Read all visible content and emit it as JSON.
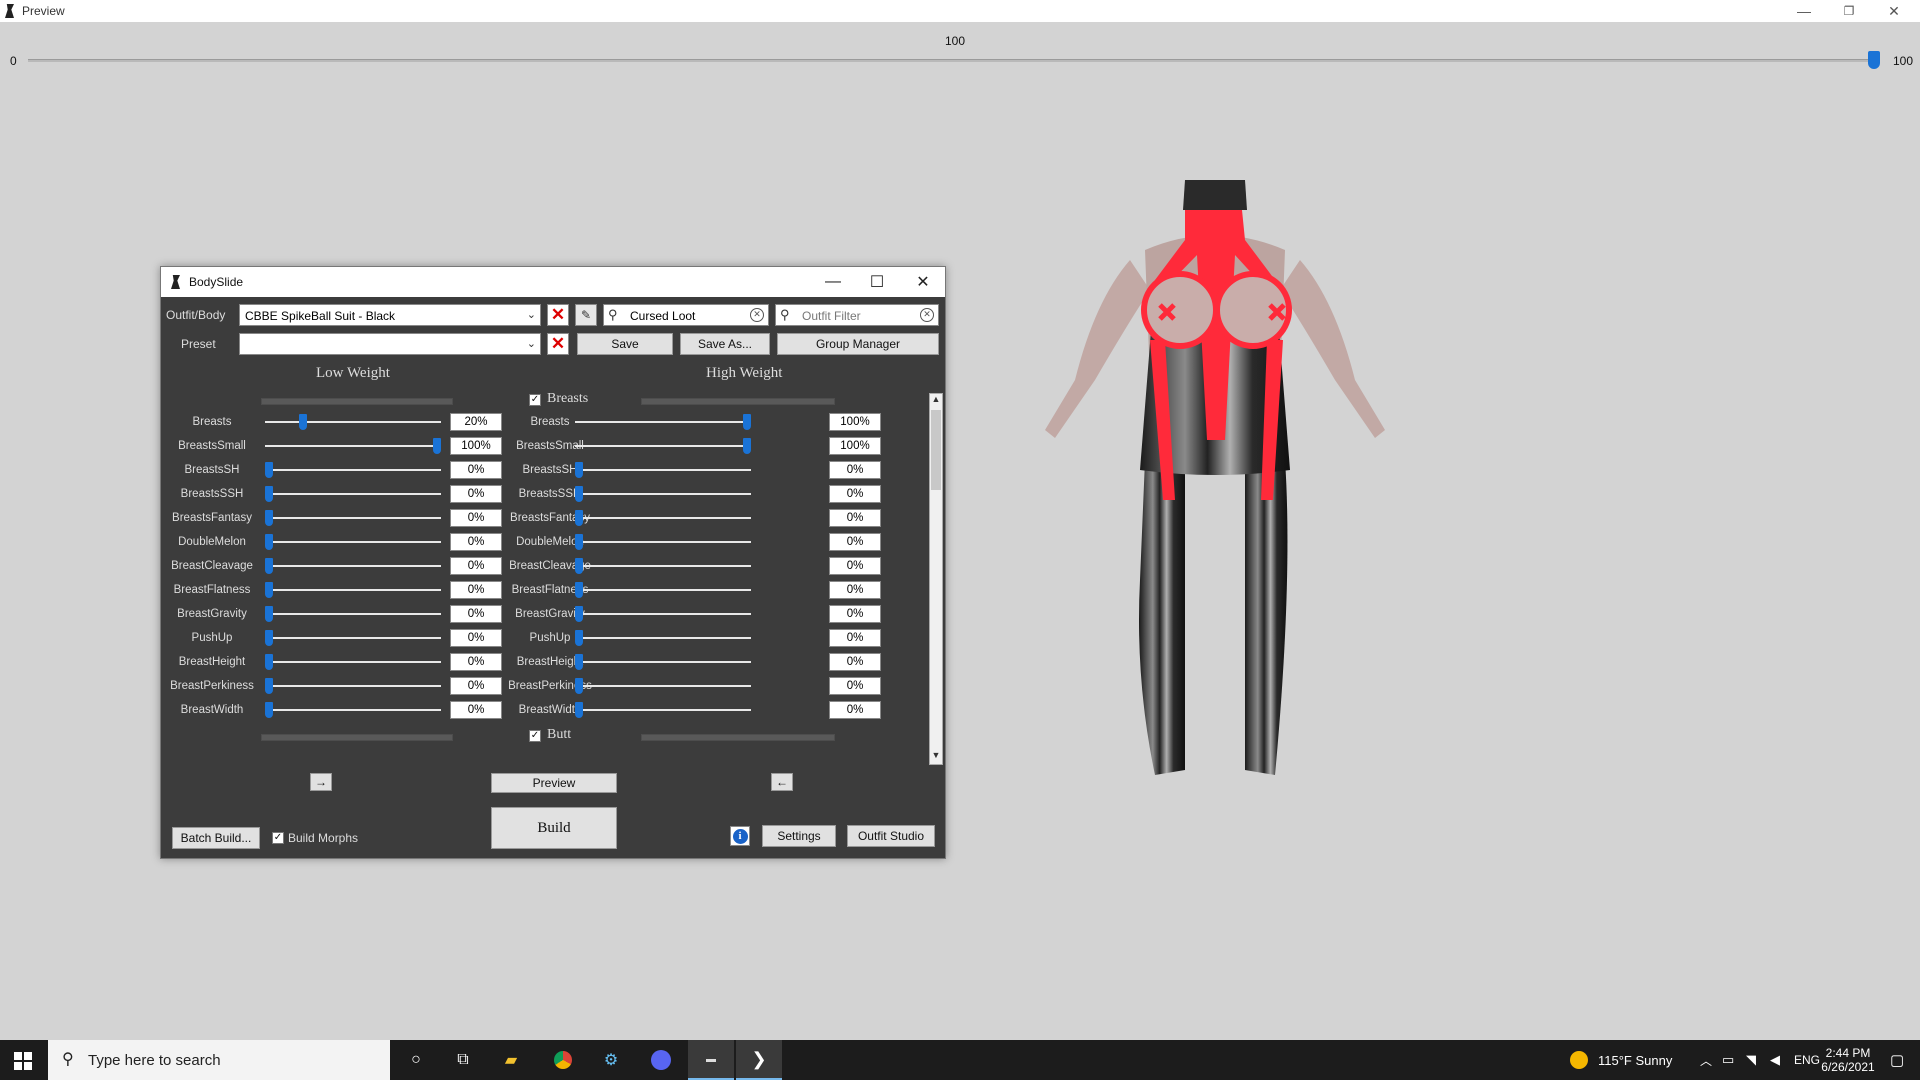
{
  "preview_window": {
    "title": "Preview",
    "controls": {
      "minimize": "—",
      "restore": "❐",
      "close": "✕"
    },
    "zoom": {
      "label": "100",
      "min": "0",
      "max": "100",
      "value": 100
    }
  },
  "bodyslide": {
    "title": "BodySlide",
    "controls": {
      "minimize": "—",
      "maximize": "☐",
      "close": "✕"
    },
    "outfit_label": "Outfit/Body",
    "outfit_value": "CBBE SpikeBall Suit - Black",
    "group_filter_value": "Cursed Loot",
    "outfit_filter_placeholder": "Outfit Filter",
    "preset_label": "Preset",
    "preset_value": "",
    "save_label": "Save",
    "save_as_label": "Save As...",
    "group_manager_label": "Group Manager",
    "low_weight_label": "Low Weight",
    "high_weight_label": "High Weight",
    "groups": [
      {
        "name": "Breasts",
        "checked": true
      },
      {
        "name": "Butt",
        "checked": true
      }
    ],
    "sliders": [
      {
        "name": "Breasts",
        "low": "20%",
        "low_pos": 0.2,
        "high": "100%",
        "high_pos": 1.0
      },
      {
        "name": "BreastsSmall",
        "low": "100%",
        "low_pos": 1.0,
        "high": "100%",
        "high_pos": 1.0
      },
      {
        "name": "BreastsSH",
        "low": "0%",
        "low_pos": 0,
        "high": "0%",
        "high_pos": 0
      },
      {
        "name": "BreastsSSH",
        "low": "0%",
        "low_pos": 0,
        "high": "0%",
        "high_pos": 0
      },
      {
        "name": "BreastsFantasy",
        "low": "0%",
        "low_pos": 0,
        "high": "0%",
        "high_pos": 0
      },
      {
        "name": "DoubleMelon",
        "low": "0%",
        "low_pos": 0,
        "high": "0%",
        "high_pos": 0
      },
      {
        "name": "BreastCleavage",
        "low": "0%",
        "low_pos": 0,
        "high": "0%",
        "high_pos": 0
      },
      {
        "name": "BreastFlatness",
        "low": "0%",
        "low_pos": 0,
        "high": "0%",
        "high_pos": 0
      },
      {
        "name": "BreastGravity",
        "low": "0%",
        "low_pos": 0,
        "high": "0%",
        "high_pos": 0
      },
      {
        "name": "PushUp",
        "low": "0%",
        "low_pos": 0,
        "high": "0%",
        "high_pos": 0
      },
      {
        "name": "BreastHeight",
        "low": "0%",
        "low_pos": 0,
        "high": "0%",
        "high_pos": 0
      },
      {
        "name": "BreastPerkiness",
        "low": "0%",
        "low_pos": 0,
        "high": "0%",
        "high_pos": 0
      },
      {
        "name": "BreastWidth",
        "low": "0%",
        "low_pos": 0,
        "high": "0%",
        "high_pos": 0
      }
    ],
    "copy_right_label": "→",
    "copy_left_label": "←",
    "preview_label": "Preview",
    "build_label": "Build",
    "batch_build_label": "Batch Build...",
    "build_morphs_label": "Build Morphs",
    "build_morphs_checked": true,
    "settings_label": "Settings",
    "outfit_studio_label": "Outfit Studio",
    "info_glyph": "i"
  },
  "taskbar": {
    "search_placeholder": "Type here to search",
    "weather": "115°F  Sunny",
    "language": "ENG",
    "time": "2:44 PM",
    "date": "6/26/2021"
  },
  "colors": {
    "accent": "#1a73d6",
    "panel": "#3c3c3c",
    "close_x": "#dd0000"
  }
}
